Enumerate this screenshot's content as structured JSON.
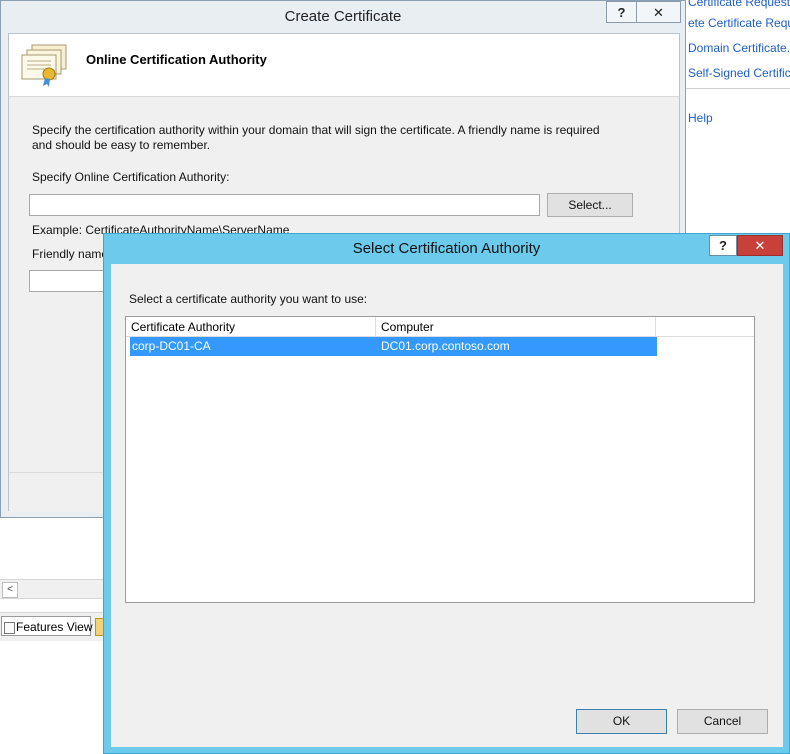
{
  "background": {
    "actions": [
      {
        "label": "Certificate Request..."
      },
      {
        "label": "ete Certificate Request..."
      },
      {
        "label": "Domain Certificate..."
      },
      {
        "label": "Self-Signed Certificate..."
      },
      {
        "label": "Help"
      }
    ],
    "scroll_left_glyph": "<",
    "features_view_label": "Features View"
  },
  "create_dialog": {
    "title": "Create Certificate",
    "help_glyph": "?",
    "close_glyph": "✕",
    "header_title": "Online Certification Authority",
    "description_line1": "Specify the certification authority within your domain that will sign the certificate. A friendly name is required",
    "description_line2": "and should be easy to remember.",
    "ca_label": "Specify Online Certification Authority:",
    "ca_value": "",
    "select_button": "Select...",
    "example_text": "Example: CertificateAuthorityName\\ServerName",
    "friendly_label": "Friendly name:",
    "friendly_value": ""
  },
  "select_dialog": {
    "title": "Select Certification Authority",
    "help_glyph": "?",
    "close_glyph": "✕",
    "prompt": "Select a certificate authority you want to use:",
    "columns": [
      "Certificate Authority",
      "Computer"
    ],
    "rows": [
      {
        "authority": "corp-DC01-CA",
        "computer": "DC01.corp.contoso.com"
      }
    ],
    "ok_label": "OK",
    "cancel_label": "Cancel"
  },
  "colors": {
    "dialog_title_bar": "#6ccbec",
    "close_button": "#c7413a",
    "selection": "#3399ff",
    "link": "#1f5ec8"
  }
}
